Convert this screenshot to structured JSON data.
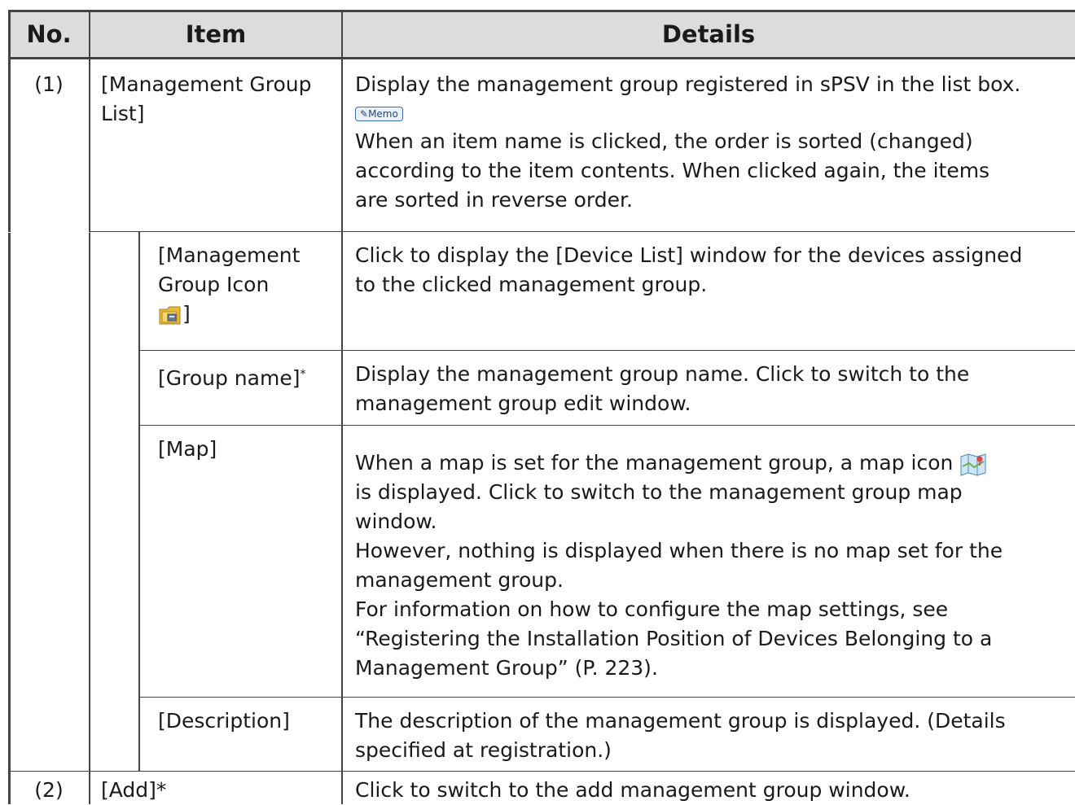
{
  "header": {
    "no": "No.",
    "item": "Item",
    "details": "Details"
  },
  "row1": {
    "no": "(1)",
    "item_line1": "[Management Group",
    "item_line2": "List]",
    "detail_line1": "Display the management group registered in sPSV in the list box.",
    "memo_label": "Memo",
    "detail_line2": "When an item name is clicked, the order is sorted (changed)",
    "detail_line3": "according to the item contents. When clicked again, the items",
    "detail_line4": "are sorted in reverse order."
  },
  "sub_icon": {
    "item_line1": "[Management",
    "item_line2": "Group Icon",
    "item_close": "]",
    "detail_line1": "Click to display the [Device List] window for the devices assigned",
    "detail_line2": "to the clicked management group.",
    "icon": "folder-icon"
  },
  "sub_group": {
    "item": "[Group name]",
    "item_mark": "*",
    "detail_line1": "Display the management group name. Click to switch to the",
    "detail_line2": "management group edit window."
  },
  "sub_map": {
    "item": "[Map]",
    "detail_line1": "When a map is set for the management group, a map icon",
    "icon": "map-icon",
    "detail_line2": "is displayed. Click to switch to the management group map",
    "detail_line3": "window.",
    "detail_line4": "However, nothing is displayed when there is no map set for the",
    "detail_line5": "management group.",
    "detail_line6": "For information on how to configure the map settings, see",
    "detail_line7": "“Registering the Installation Position of Devices Belonging to a",
    "detail_line8": "Management Group” (P. 223)."
  },
  "sub_desc": {
    "item": "[Description]",
    "detail_line1": "The description of the management group is displayed. (Details",
    "detail_line2": "specified at registration.)"
  },
  "row2": {
    "no": "(2)",
    "item": "[Add]*",
    "detail": "Click to switch to the add management group window."
  },
  "colors": {
    "header_bg": "#dcdcdc",
    "border": "#444444",
    "memo_accent": "#3b6db4"
  }
}
